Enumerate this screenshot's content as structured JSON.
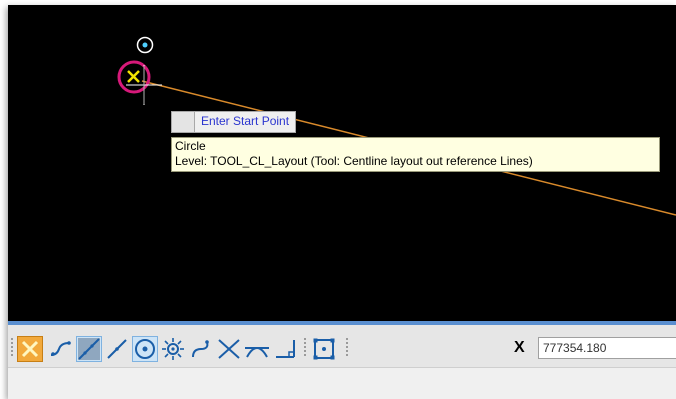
{
  "viewport": {
    "background": "#000000",
    "line_color": "#d98a2b",
    "snap_marker_color": "#d7197a",
    "snap_x_color": "#f2e400",
    "prompt": "Enter Start Point",
    "tooltip": {
      "element_type": "Circle",
      "level_text": "Level: TOOL_CL_Layout (Tool: Centline layout out reference Lines)"
    }
  },
  "toolbar": {
    "tools": [
      {
        "icon": "snap-toggle-icon",
        "state": "active"
      },
      {
        "icon": "keypoint-snap-icon",
        "state": "normal"
      },
      {
        "icon": "nearest-snap-icon",
        "state": "active"
      },
      {
        "icon": "midpoint-snap-icon",
        "state": "normal"
      },
      {
        "icon": "center-snap-icon",
        "state": "active"
      },
      {
        "icon": "origin-snap-icon",
        "state": "normal"
      },
      {
        "icon": "bisector-snap-icon",
        "state": "normal"
      },
      {
        "icon": "intersection-snap-icon",
        "state": "normal"
      },
      {
        "icon": "tangent-snap-icon",
        "state": "normal"
      },
      {
        "icon": "perpendicular-snap-icon",
        "state": "normal"
      },
      {
        "icon": "point-on-snap-icon",
        "state": "normal"
      }
    ],
    "x_label": "X",
    "x_value": "777354.180"
  }
}
